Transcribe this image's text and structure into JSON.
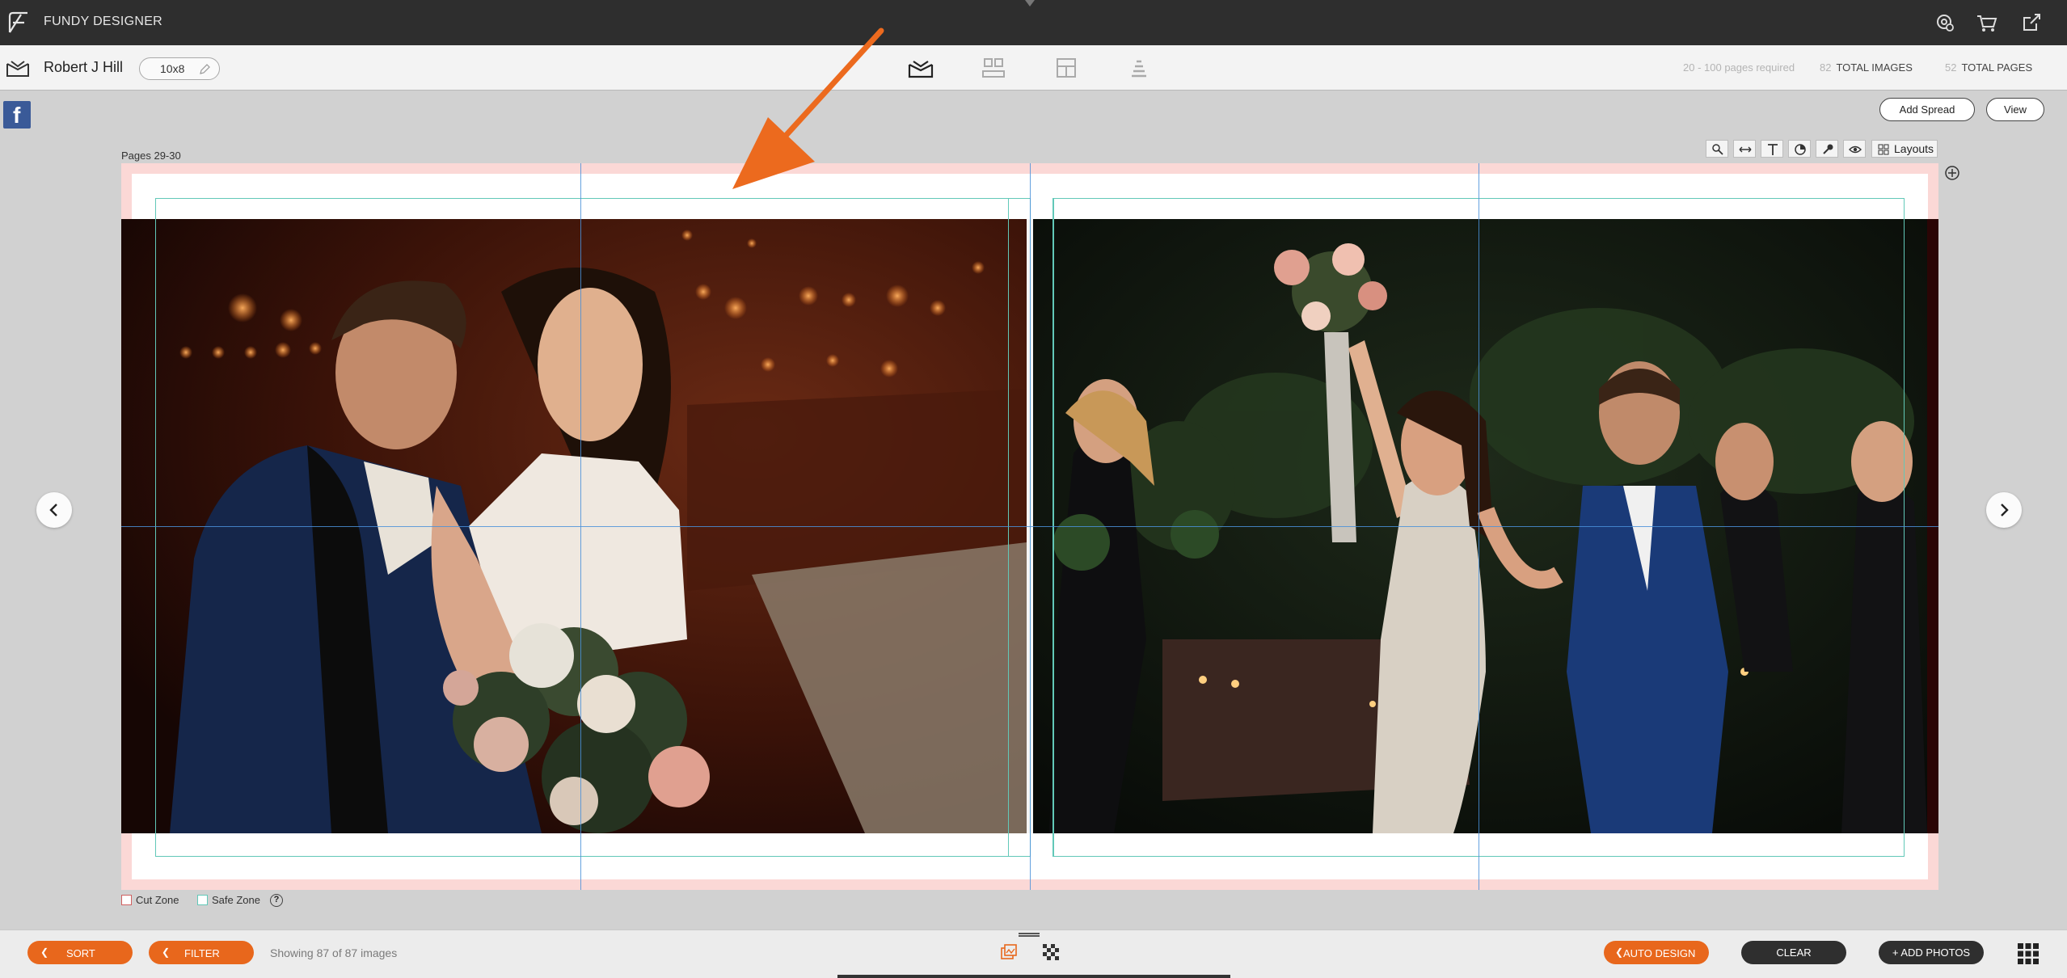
{
  "app": {
    "title": "FUNDY DESIGNER"
  },
  "topbar_icons": [
    "settings-gear-icon",
    "cart-icon",
    "export-icon"
  ],
  "toolbar": {
    "client_name": "Robert J Hill",
    "album_size": "10x8",
    "mode_icons": [
      "album-design-icon",
      "proof-gallery-icon",
      "wall-art-icon",
      "stack-icon"
    ],
    "pages_required": "20 - 100 pages required",
    "total_images_count": "82",
    "total_images_label": "TOTAL IMAGES",
    "total_pages_count": "52",
    "total_pages_label": "TOTAL PAGES"
  },
  "actions": {
    "add_spread": "Add Spread",
    "view": "View"
  },
  "spread": {
    "pages_label": "Pages 29-30",
    "layouts_label": "Layouts",
    "tools": [
      "zoom-icon",
      "swap-icon",
      "text-icon",
      "color-icon",
      "eyedropper-icon",
      "preview-eye-icon"
    ]
  },
  "legend": {
    "cut_zone": "Cut Zone",
    "safe_zone": "Safe Zone",
    "help": "?"
  },
  "bottom": {
    "sort": "SORT",
    "filter": "FILTER",
    "showing": "Showing 87 of 87 images",
    "auto_design": "AUTO DESIGN",
    "clear": "CLEAR",
    "add_photos": "+ ADD PHOTOS"
  },
  "colors": {
    "accent": "#e8671c",
    "topbar": "#2e2e2e",
    "guide": "#4a90d9",
    "safe_zone": "#62c8b8",
    "cut_zone": "#fbd8d6"
  }
}
